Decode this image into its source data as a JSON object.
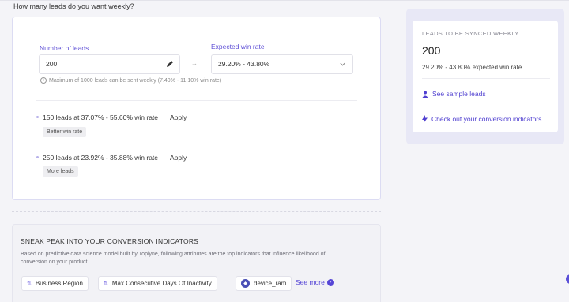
{
  "question": "How many leads do you want weekly?",
  "form": {
    "leads_label": "Number of leads",
    "leads_value": "200",
    "win_label": "Expected win rate",
    "win_value": "29.20% - 43.80%",
    "arrow": "→",
    "hint": "Maximum of 1000 leads can be sent weekly (7.40% - 11.10% win rate)"
  },
  "suggestions": [
    {
      "text": "150 leads at 37.07% - 55.60% win rate",
      "action": "Apply",
      "tag": "Better win rate"
    },
    {
      "text": "250 leads at 23.92% - 35.88% win rate",
      "action": "Apply",
      "tag": "More leads"
    }
  ],
  "sneak": {
    "title": "SNEAK PEAK INTO YOUR CONVERSION INDICATORS",
    "description": "Based on predictive data science model built by Toplyne, following attributes are the top indicators that influence likelihood of conversion on your product.",
    "chips": [
      {
        "label": "Business Region",
        "icon": "sort-icon"
      },
      {
        "label": "Max Consecutive Days Of Inactivity",
        "icon": "sort-icon"
      },
      {
        "label": "device_ram",
        "icon": "device-icon"
      }
    ],
    "see_more": "See more"
  },
  "sidebar": {
    "heading": "LEADS TO BE SYNCED WEEKLY",
    "count": "200",
    "rate": "29.20% - 43.80% expected win rate",
    "link_sample": "See sample leads",
    "link_indicators": "Check out your conversion indicators"
  },
  "colors": {
    "accent": "#5646d6",
    "background": "#f4f4f8",
    "panel": "#e8e8f6"
  }
}
